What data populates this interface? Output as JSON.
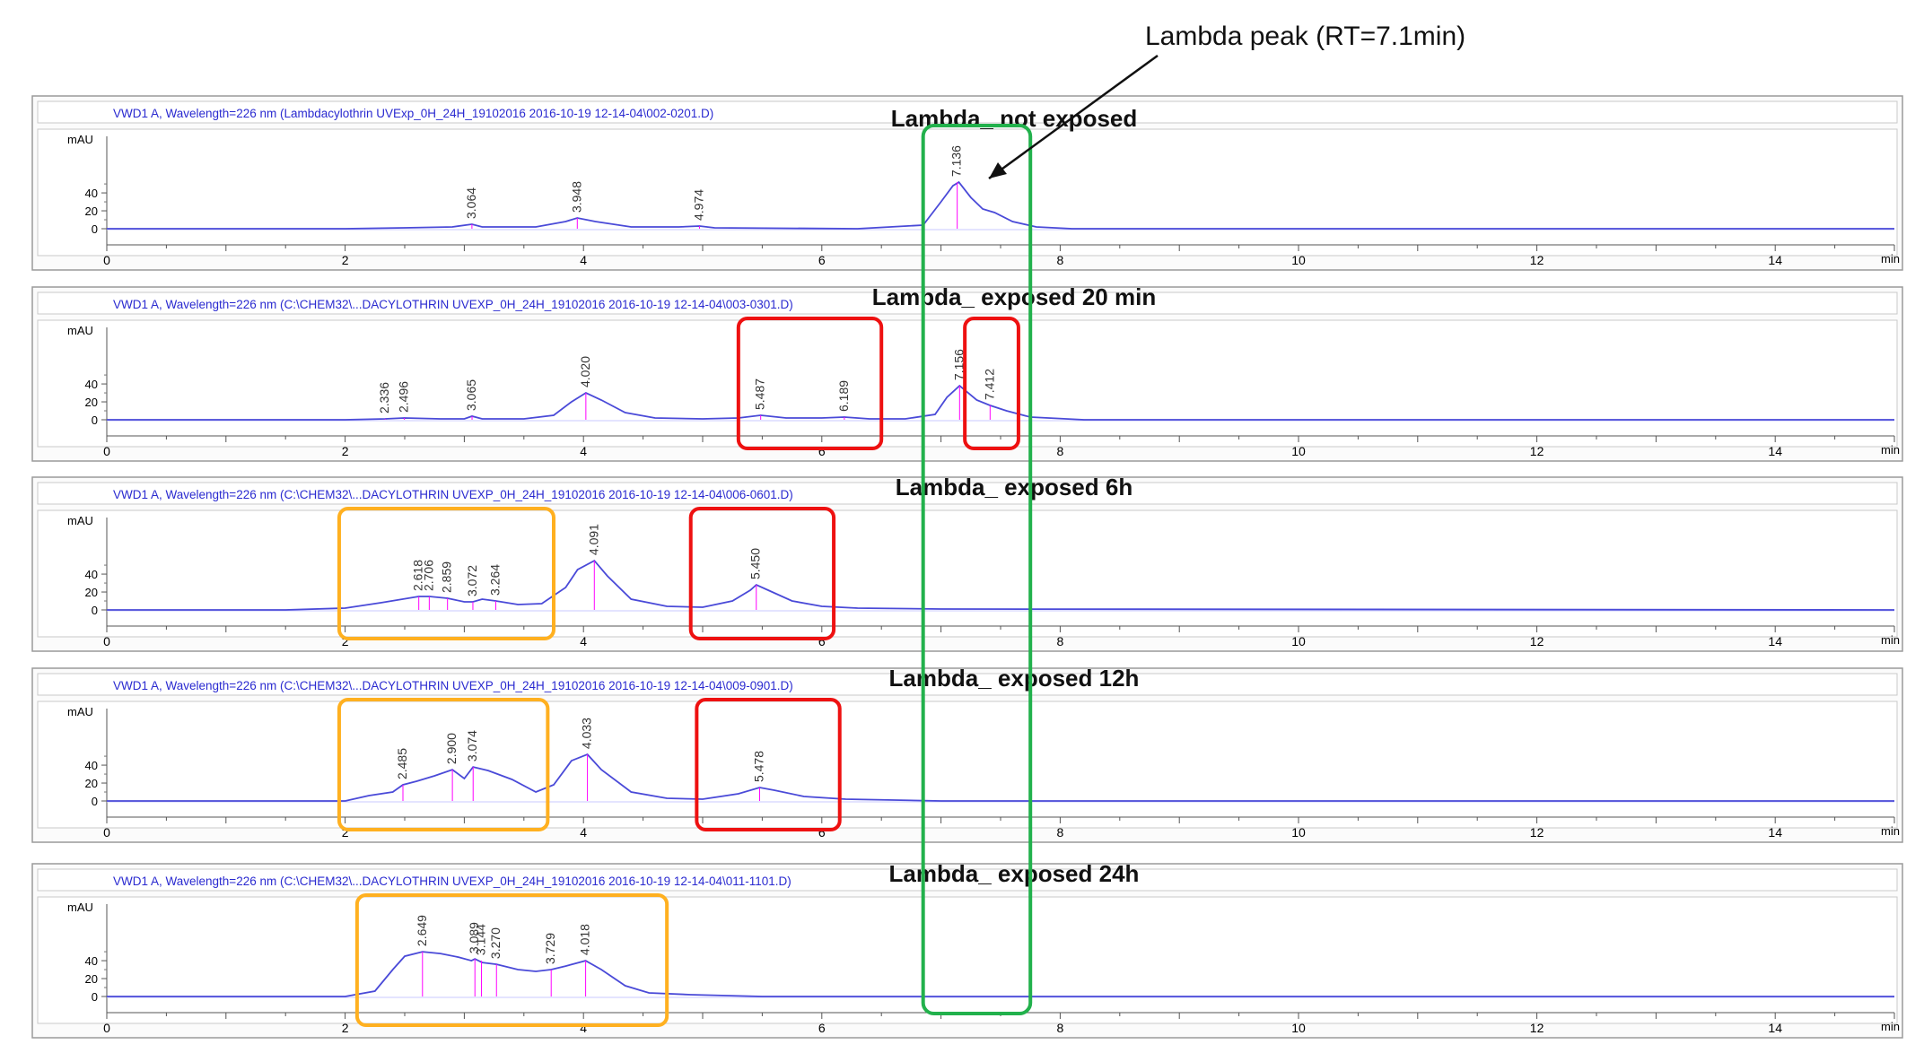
{
  "annotation": {
    "text": "Lambda peak (RT=7.1min)"
  },
  "colors": {
    "trace": "#4a4ad8",
    "baseline": "#ff00ff",
    "header_text": "#2a2ad0",
    "box_green": "#22b14c",
    "box_red": "#ee1111",
    "box_orange": "#ffb020",
    "frame": "#9a9a9a"
  },
  "chart_data": [
    {
      "type": "line",
      "header": "VWD1 A, Wavelength=226 nm (Lambdacylothrin UVExp_0H_24H_19102016 2016-10-19 12-14-04\\002-0201.D)",
      "title": "Lambda_ not exposed",
      "ylabel": "mAU",
      "xunit": "min",
      "xlim": [
        0,
        15
      ],
      "ylim": [
        -5,
        60
      ],
      "xticks": [
        0,
        2,
        4,
        6,
        8,
        10,
        12,
        14
      ],
      "yticks": [
        0,
        20,
        40
      ],
      "x": [
        0,
        2,
        2.5,
        2.9,
        3.064,
        3.15,
        3.6,
        3.85,
        3.948,
        4.1,
        4.4,
        4.8,
        4.974,
        5.1,
        6.3,
        6.85,
        7.0,
        7.1,
        7.15,
        7.25,
        7.35,
        7.45,
        7.6,
        7.8,
        8.1,
        15
      ],
      "y": [
        0,
        0,
        1,
        2,
        5,
        2,
        2,
        8,
        12,
        8,
        2,
        2,
        3,
        1,
        0,
        4,
        30,
        48,
        52,
        35,
        22,
        18,
        8,
        2,
        0,
        0
      ],
      "peak_labels": [
        {
          "rt": "3.064",
          "y": 5
        },
        {
          "rt": "3.948",
          "y": 12
        },
        {
          "rt": "4.974",
          "y": 3
        },
        {
          "rt": "7.136",
          "y": 52
        }
      ],
      "highlight_boxes": []
    },
    {
      "type": "line",
      "header": "VWD1 A, Wavelength=226 nm (C:\\CHEM32\\...DACYLOTHRIN UVEXP_0H_24H_19102016 2016-10-19 12-14-04\\003-0301.D)",
      "title": "Lambda_ exposed 20 min",
      "ylabel": "mAU",
      "xunit": "min",
      "xlim": [
        0,
        15
      ],
      "ylim": [
        -5,
        60
      ],
      "xticks": [
        0,
        2,
        4,
        6,
        8,
        10,
        12,
        14
      ],
      "yticks": [
        0,
        20,
        40
      ],
      "x": [
        0,
        2,
        2.336,
        2.496,
        2.8,
        3.0,
        3.065,
        3.15,
        3.5,
        3.75,
        3.9,
        4.02,
        4.15,
        4.35,
        4.6,
        5.0,
        5.3,
        5.487,
        5.7,
        6.0,
        6.189,
        6.4,
        6.7,
        6.95,
        7.05,
        7.156,
        7.3,
        7.412,
        7.55,
        7.75,
        8.2,
        15
      ],
      "y": [
        0,
        0,
        1,
        2,
        1,
        1,
        4,
        1,
        1,
        5,
        20,
        30,
        22,
        8,
        2,
        1,
        2,
        5,
        2,
        2,
        3,
        1,
        1,
        6,
        25,
        38,
        22,
        16,
        10,
        3,
        0,
        0
      ],
      "peak_labels": [
        {
          "rt": "2.336",
          "y": 1
        },
        {
          "rt": "2.496",
          "y": 2
        },
        {
          "rt": "3.065",
          "y": 4
        },
        {
          "rt": "4.020",
          "y": 30
        },
        {
          "rt": "5.487",
          "y": 5
        },
        {
          "rt": "6.189",
          "y": 3
        },
        {
          "rt": "7.156",
          "y": 38
        },
        {
          "rt": "7.412",
          "y": 16
        }
      ],
      "highlight_boxes": [
        {
          "color": "red",
          "x0": 5.3,
          "x1": 6.5
        },
        {
          "color": "red",
          "x0": 7.2,
          "x1": 7.65
        }
      ]
    },
    {
      "type": "line",
      "header": "VWD1 A, Wavelength=226 nm (C:\\CHEM32\\...DACYLOTHRIN UVEXP_0H_24H_19102016 2016-10-19 12-14-04\\006-0601.D)",
      "title": "Lambda_ exposed 6h",
      "ylabel": "mAU",
      "xunit": "min",
      "xlim": [
        0,
        15
      ],
      "ylim": [
        -5,
        60
      ],
      "xticks": [
        0,
        2,
        4,
        6,
        8,
        10,
        12,
        14
      ],
      "yticks": [
        0,
        20,
        40
      ],
      "x": [
        0,
        1.5,
        2.0,
        2.3,
        2.618,
        2.706,
        2.859,
        3.0,
        3.072,
        3.15,
        3.264,
        3.45,
        3.65,
        3.85,
        3.95,
        4.091,
        4.2,
        4.4,
        4.7,
        5.0,
        5.25,
        5.4,
        5.45,
        5.55,
        5.75,
        6.0,
        6.3,
        7.0,
        15
      ],
      "y": [
        0,
        0,
        2,
        8,
        15,
        15,
        13,
        9,
        9,
        12,
        10,
        6,
        7,
        25,
        45,
        55,
        38,
        12,
        4,
        3,
        10,
        22,
        28,
        22,
        10,
        4,
        2,
        1,
        0
      ],
      "peak_labels": [
        {
          "rt": "2.618",
          "y": 15
        },
        {
          "rt": "2.706",
          "y": 15
        },
        {
          "rt": "2.859",
          "y": 13
        },
        {
          "rt": "3.072",
          "y": 9
        },
        {
          "rt": "3.264",
          "y": 10
        },
        {
          "rt": "4.091",
          "y": 55
        },
        {
          "rt": "5.450",
          "y": 28
        }
      ],
      "highlight_boxes": [
        {
          "color": "orange",
          "x0": 1.95,
          "x1": 3.75
        },
        {
          "color": "red",
          "x0": 4.9,
          "x1": 6.1
        }
      ]
    },
    {
      "type": "line",
      "header": "VWD1 A, Wavelength=226 nm (C:\\CHEM32\\...DACYLOTHRIN UVEXP_0H_24H_19102016 2016-10-19 12-14-04\\009-0901.D)",
      "title": "Lambda_ exposed 12h",
      "ylabel": "mAU",
      "xunit": "min",
      "xlim": [
        0,
        15
      ],
      "ylim": [
        -5,
        60
      ],
      "xticks": [
        0,
        2,
        4,
        6,
        8,
        10,
        12,
        14
      ],
      "yticks": [
        0,
        20,
        40
      ],
      "x": [
        0,
        2.0,
        2.2,
        2.4,
        2.485,
        2.6,
        2.75,
        2.9,
        3.0,
        3.074,
        3.2,
        3.4,
        3.6,
        3.75,
        3.9,
        4.033,
        4.15,
        4.4,
        4.7,
        5.0,
        5.3,
        5.478,
        5.6,
        5.85,
        6.2,
        7.0,
        15
      ],
      "y": [
        0,
        0,
        6,
        10,
        18,
        22,
        28,
        35,
        25,
        38,
        34,
        24,
        10,
        18,
        45,
        52,
        35,
        10,
        3,
        2,
        8,
        15,
        12,
        5,
        2,
        0,
        0
      ],
      "peak_labels": [
        {
          "rt": "2.485",
          "y": 18
        },
        {
          "rt": "2.900",
          "y": 35
        },
        {
          "rt": "3.074",
          "y": 38
        },
        {
          "rt": "4.033",
          "y": 52
        },
        {
          "rt": "5.478",
          "y": 15
        }
      ],
      "highlight_boxes": [
        {
          "color": "orange",
          "x0": 1.95,
          "x1": 3.7
        },
        {
          "color": "red",
          "x0": 4.95,
          "x1": 6.15
        }
      ]
    },
    {
      "type": "line",
      "header": "VWD1 A, Wavelength=226 nm (C:\\CHEM32\\...DACYLOTHRIN UVEXP_0H_24H_19102016 2016-10-19 12-14-04\\011-1101.D)",
      "title": "Lambda_ exposed 24h",
      "ylabel": "mAU",
      "xunit": "min",
      "xlim": [
        0,
        15
      ],
      "ylim": [
        -5,
        60
      ],
      "xticks": [
        0,
        2,
        4,
        6,
        8,
        10,
        12,
        14
      ],
      "yticks": [
        0,
        20,
        40
      ],
      "x": [
        0,
        2.0,
        2.25,
        2.4,
        2.5,
        2.649,
        2.8,
        2.95,
        3.06,
        3.089,
        3.15,
        3.27,
        3.45,
        3.6,
        3.729,
        3.85,
        4.018,
        4.15,
        4.35,
        4.55,
        4.9,
        5.5,
        15
      ],
      "y": [
        0,
        0,
        6,
        30,
        45,
        50,
        48,
        44,
        40,
        42,
        38,
        36,
        30,
        28,
        30,
        34,
        40,
        30,
        12,
        4,
        2,
        0,
        0
      ],
      "peak_labels": [
        {
          "rt": "2.649",
          "y": 50
        },
        {
          "rt": "3.089",
          "y": 42
        },
        {
          "rt": "3.144",
          "y": 40
        },
        {
          "rt": "3.270",
          "y": 36
        },
        {
          "rt": "3.729",
          "y": 30
        },
        {
          "rt": "4.018",
          "y": 40
        }
      ],
      "highlight_boxes": [
        {
          "color": "orange",
          "x0": 2.1,
          "x1": 4.7
        }
      ]
    }
  ]
}
